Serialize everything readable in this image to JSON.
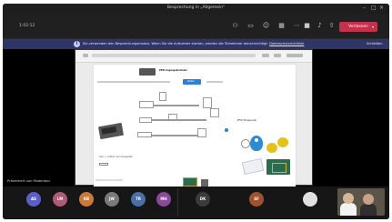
{
  "window": {
    "title": "Besprechung in „Allgemein“"
  },
  "toolbar": {
    "timer": "1:02:12",
    "leave_label": "Verlassen",
    "icons": [
      "participants-icon",
      "chat-icon",
      "reactions-icon",
      "rooms-icon",
      "more-icon",
      "camera-icon",
      "mic-icon",
      "share-icon"
    ]
  },
  "banner": {
    "text": "Sie verwenden den Besprechungsmodus. Wenn Sie die Aufnahme starten, werden die Teilnehmer benachrichtigt.",
    "link_text": "Datenschutzrichtlinie",
    "dismiss": "Schließen"
  },
  "stage": {
    "presenter": "Präsentiert von Moderator",
    "shared_doc": {
      "heading": "RFID Zugangskontrolle",
      "caption": "Abb. 1: Aufbau des Lesegeräts",
      "button_label": "Weiter",
      "right_panel_title": "RFID Transponder"
    }
  },
  "participants": [
    {
      "initials": "AS",
      "color": "#5b5fc7"
    },
    {
      "initials": "LM",
      "color": "#b05a7a"
    },
    {
      "initials": "KB",
      "color": "#c97a3a"
    },
    {
      "initials": "JW",
      "color": "#7a7a7a"
    },
    {
      "initials": "TR",
      "color": "#4a6fa5"
    },
    {
      "initials": "MH",
      "color": "#8a4a9a"
    }
  ],
  "participants_right": [
    {
      "initials": "DK",
      "color": "#3b3b3b"
    },
    {
      "initials": "SF",
      "color": "#a0522d"
    },
    {
      "initials": "",
      "color": "#e0e0e0"
    }
  ]
}
